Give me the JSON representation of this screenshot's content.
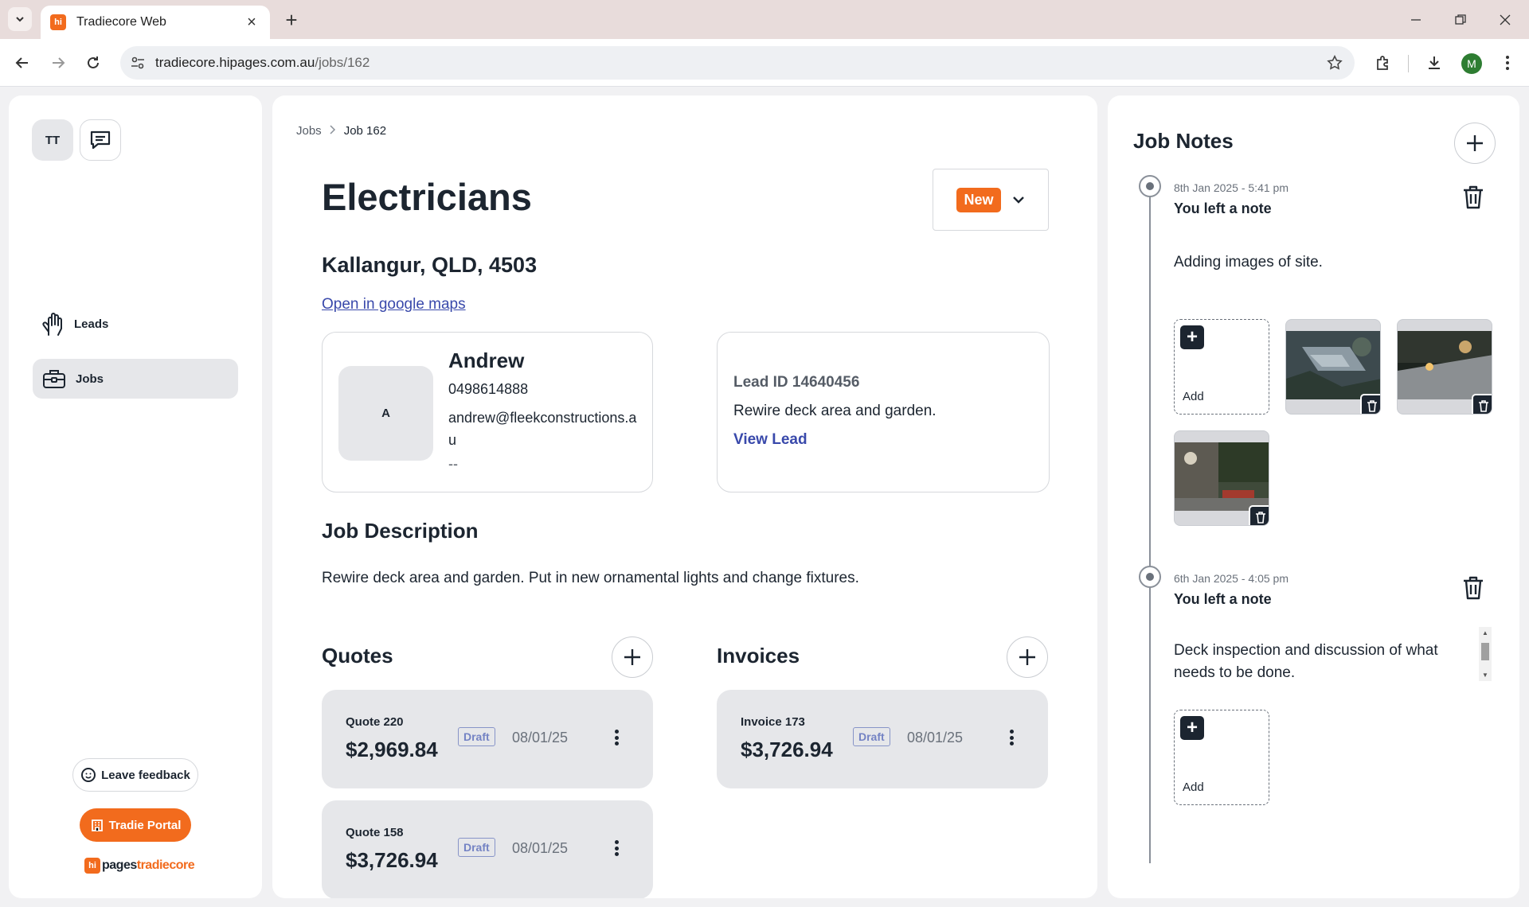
{
  "browser": {
    "tab_title": "Tradiecore Web",
    "tab_favicon": "hi",
    "url_host": "tradiecore.hipages.com.au",
    "url_path": "/jobs/162",
    "profile_initial": "M"
  },
  "sidebar": {
    "user_initials": "TT",
    "nav": [
      {
        "label": "Leads",
        "icon": "hand-icon"
      },
      {
        "label": "Jobs",
        "icon": "briefcase-icon",
        "active": true
      }
    ],
    "feedback_label": "Leave feedback",
    "portal_label": "Tradie Portal",
    "brand": {
      "hi": "hi",
      "pages": "pages",
      "tradiecore": "tradiecore"
    }
  },
  "main": {
    "breadcrumb": {
      "root": "Jobs",
      "current": "Job 162"
    },
    "title": "Electricians",
    "status": "New",
    "location": "Kallangur, QLD, 4503",
    "maps_link": "Open in google maps",
    "contact": {
      "initial": "A",
      "name": "Andrew",
      "phone": "0498614888",
      "email": "andrew@fleekconstructions.au",
      "extra": "--"
    },
    "lead": {
      "id_label": "Lead ID 14640456",
      "description": "Rewire deck area and garden.",
      "link": "View Lead"
    },
    "job_description_heading": "Job Description",
    "job_description": "Rewire deck area and garden. Put in new ornamental lights and change fixtures.",
    "quotes_heading": "Quotes",
    "quotes": [
      {
        "label": "Quote 220",
        "amount": "$2,969.84",
        "status": "Draft",
        "date": "08/01/25"
      },
      {
        "label": "Quote 158",
        "amount": "$3,726.94",
        "status": "Draft",
        "date": "08/01/25"
      }
    ],
    "invoices_heading": "Invoices",
    "invoices": [
      {
        "label": "Invoice 173",
        "amount": "$3,726.94",
        "status": "Draft",
        "date": "08/01/25"
      }
    ]
  },
  "notes": {
    "title": "Job Notes",
    "add_tile_label": "Add",
    "items": [
      {
        "time": "8th Jan 2025 - 5:41 pm",
        "author": "You left a note",
        "text": "Adding images of site."
      },
      {
        "time": "6th Jan 2025 - 4:05 pm",
        "author": "You left a note",
        "text": "Deck inspection and discussion of what needs to be done."
      }
    ]
  },
  "colors": {
    "brand_orange": "#f26b1d",
    "link_blue": "#3949ab",
    "dark": "#1c2530"
  }
}
